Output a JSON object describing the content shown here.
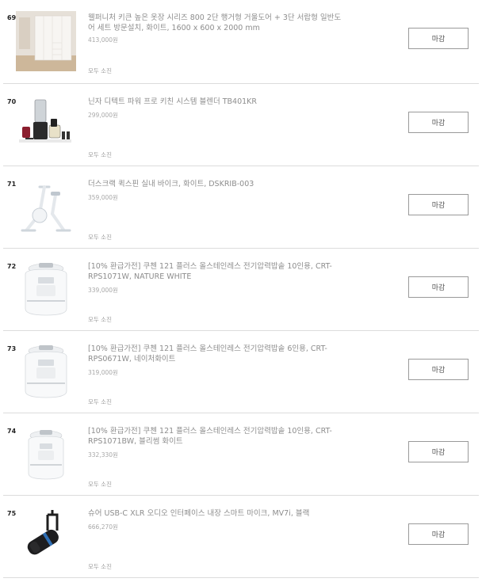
{
  "items": [
    {
      "rank": "69",
      "title": "웰퍼니처 키큰 높은 옷장 시리즈 800 2단 행거형 거울도어 + 3단 서랍형 일반도어 세트 방문설치, 화이트, 1600 x 600 x 2000 mm",
      "price": "413,000원",
      "status": "모두 소진",
      "button": "마감",
      "image": "wardrobe-image"
    },
    {
      "rank": "70",
      "title": "닌자 디텍트 파워 프로 키친 시스템 블렌더 TB401KR",
      "price": "299,000원",
      "status": "모두 소진",
      "button": "마감",
      "image": "blender-image"
    },
    {
      "rank": "71",
      "title": "더스크랙 퀵스핀 실내 바이크, 화이트, DSKRIB-003",
      "price": "359,000원",
      "status": "모두 소진",
      "button": "마감",
      "image": "exercise-bike-image"
    },
    {
      "rank": "72",
      "title": "[10% 환급가전] 쿠첸 121 플러스 올스테인레스 전기압력밥솥 10인용, CRT-RPS1071W, NATURE WHITE",
      "price": "339,000원",
      "status": "모두 소진",
      "button": "마감",
      "image": "rice-cooker-image"
    },
    {
      "rank": "73",
      "title": "[10% 환급가전] 쿠첸 121 플러스 올스테인레스 전기압력밥솥 6인용, CRT-RPS0671W, 네이처화이트",
      "price": "319,000원",
      "status": "모두 소진",
      "button": "마감",
      "image": "rice-cooker-image"
    },
    {
      "rank": "74",
      "title": "[10% 환급가전] 쿠첸 121 플러스 올스테인레스 전기압력밥솥 10인용, CRT-RPS1071BW, 블리썸 화이트",
      "price": "332,330원",
      "status": "모두 소진",
      "button": "마감",
      "image": "rice-cooker-image"
    },
    {
      "rank": "75",
      "title": "슈어 USB-C XLR 오디오 인터페이스 내장 스마트 마이크, MV7i, 블랙",
      "price": "666,270원",
      "status": "모두 소진",
      "button": "마감",
      "image": "microphone-image"
    }
  ]
}
